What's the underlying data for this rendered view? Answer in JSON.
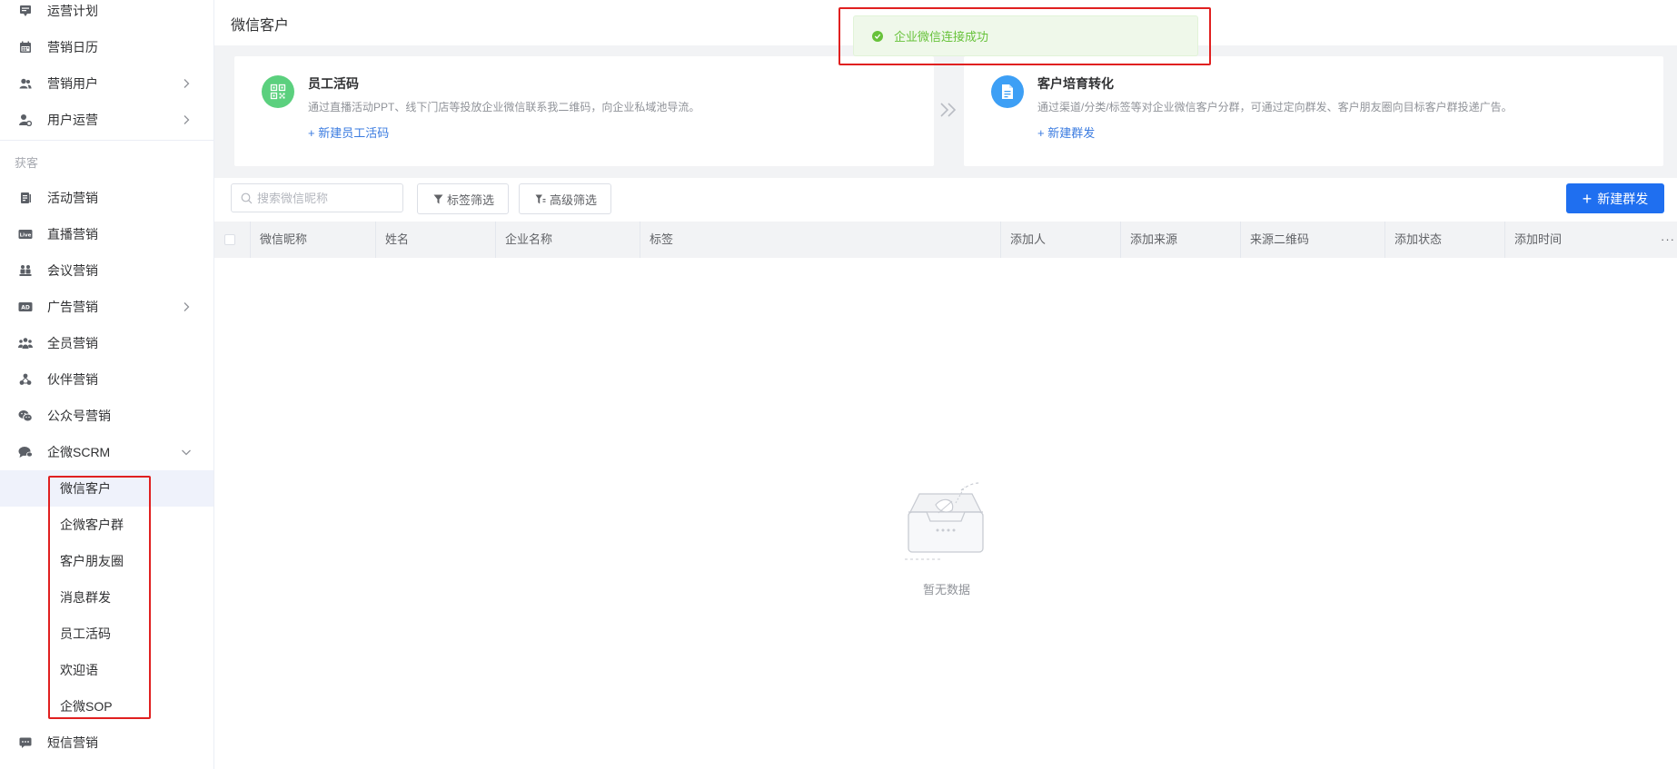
{
  "sidebar": {
    "items_top": [
      {
        "label": "运营计划",
        "icon": "chat-board-icon"
      },
      {
        "label": "营销日历",
        "icon": "calendar-icon"
      },
      {
        "label": "营销用户",
        "icon": "users-icon",
        "expandable": true
      },
      {
        "label": "用户运营",
        "icon": "user-settings-icon",
        "expandable": true
      }
    ],
    "group_title": "获客",
    "items_acquire": [
      {
        "label": "活动营销",
        "icon": "document-icon"
      },
      {
        "label": "直播营销",
        "icon": "live-icon"
      },
      {
        "label": "会议营销",
        "icon": "meeting-icon"
      },
      {
        "label": "广告营销",
        "icon": "ad-icon",
        "expandable": true
      },
      {
        "label": "全员营销",
        "icon": "team-icon"
      },
      {
        "label": "伙伴营销",
        "icon": "partner-icon"
      },
      {
        "label": "公众号营销",
        "icon": "wechat-icon"
      },
      {
        "label": "企微SCRM",
        "icon": "chat-bubble-icon",
        "expanded": true
      }
    ],
    "scrm_children": [
      "微信客户",
      "企微客户群",
      "客户朋友圈",
      "消息群发",
      "员工活码",
      "欢迎语",
      "企微SOP"
    ],
    "active_child": "微信客户",
    "item_bottom": {
      "label": "短信营销",
      "icon": "sms-icon"
    }
  },
  "header": {
    "title": "微信客户"
  },
  "toast": {
    "message": "企业微信连接成功",
    "type": "success"
  },
  "cards": [
    {
      "title": "员工活码",
      "desc": "通过直播活动PPT、线下门店等投放企业微信联系我二维码，向企业私域池导流。",
      "link": "+ 新建员工活码",
      "icon": "qrcode-icon",
      "color": "#5bd07e"
    },
    {
      "title": "客户培育转化",
      "desc": "通过渠道/分类/标签等对企业微信客户分群，可通过定向群发、客户朋友圈向目标客户群投递广告。",
      "link": "+ 新建群发",
      "icon": "file-icon",
      "color": "#3d9ff5"
    }
  ],
  "toolbar": {
    "search_placeholder": "搜索微信昵称",
    "tag_filter": "标签筛选",
    "advanced_filter": "高级筛选",
    "new_broadcast": "新建群发"
  },
  "table": {
    "columns": [
      "微信昵称",
      "姓名",
      "企业名称",
      "标签",
      "添加人",
      "添加来源",
      "来源二维码",
      "添加状态",
      "添加时间"
    ],
    "rows": [],
    "more": "···"
  },
  "empty": {
    "text": "暂无数据"
  },
  "colors": {
    "primary": "#1f6ff0",
    "success": "#67c23a",
    "highlight_box": "#e02020"
  }
}
